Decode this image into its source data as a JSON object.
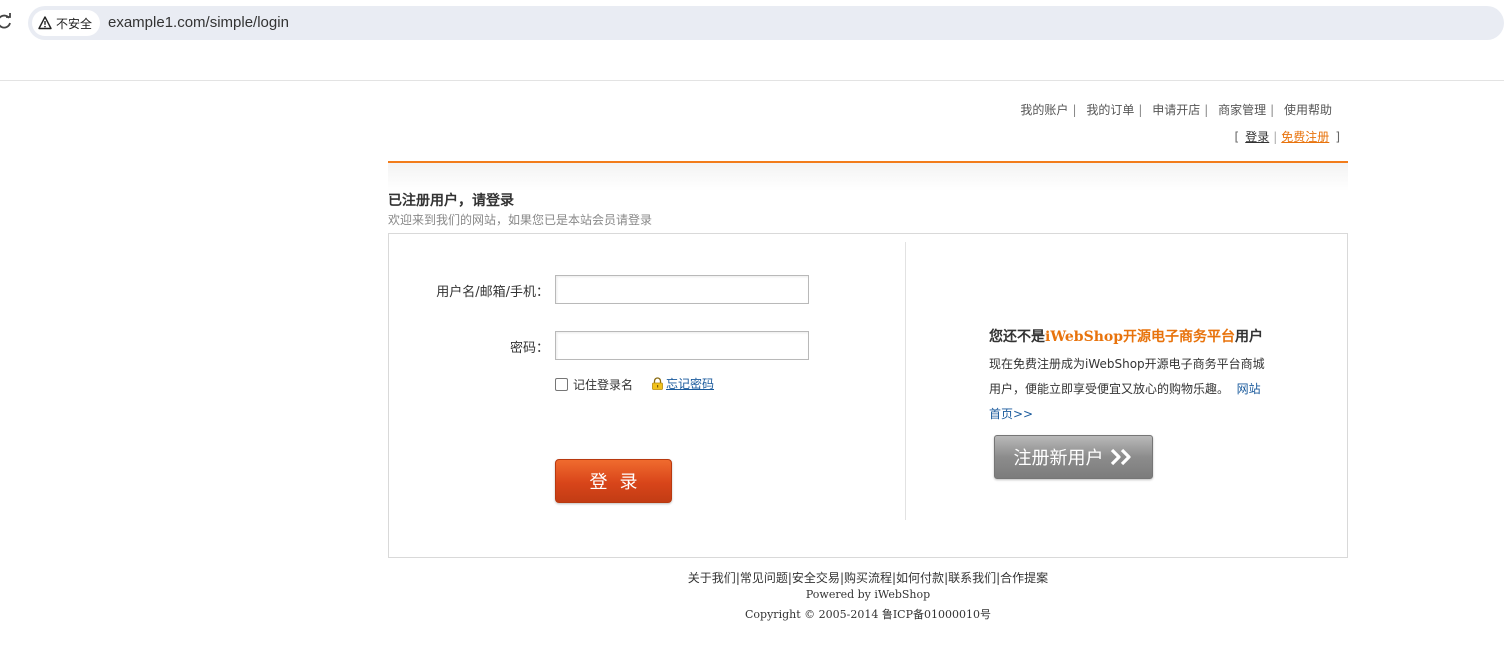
{
  "browser": {
    "security_label": "不安全",
    "url": "example1.com/simple/login"
  },
  "top_nav": {
    "items": [
      "我的账户",
      "我的订单",
      "申请开店",
      "商家管理",
      "使用帮助"
    ],
    "login_label": "登录",
    "register_label": "免费注册"
  },
  "login": {
    "title": "已注册用户，请登录",
    "subtitle": "欢迎来到我们的网站，如果您已是本站会员请登录",
    "username_label": "用户名/邮箱/手机：",
    "username_value": "",
    "password_label": "密码：",
    "password_value": "",
    "remember_label": "记住登录名",
    "forgot_label": "忘记密码",
    "submit_label": "登录"
  },
  "promo": {
    "title_prefix": "您还不是",
    "title_brand": "iWebShop开源电子商务平台",
    "title_suffix": "用户",
    "body": "现在免费注册成为iWebShop开源电子商务平台商城用户，便能立即享受便宜又放心的购物乐趣。",
    "home_link": "网站首页>>",
    "register_button": "注册新用户"
  },
  "footer": {
    "links": [
      "关于我们",
      "常见问题",
      "安全交易",
      "购买流程",
      "如何付款",
      "联系我们",
      "合作提案"
    ],
    "powered": "Powered by iWebShop",
    "copyright": "Copyright © 2005-2014 鲁ICP备01000010号"
  },
  "colors": {
    "accent_orange": "#f27c1b",
    "login_button": "#d8451a",
    "register_button": "#8c8c8c",
    "link_blue": "#1a5a9c"
  }
}
